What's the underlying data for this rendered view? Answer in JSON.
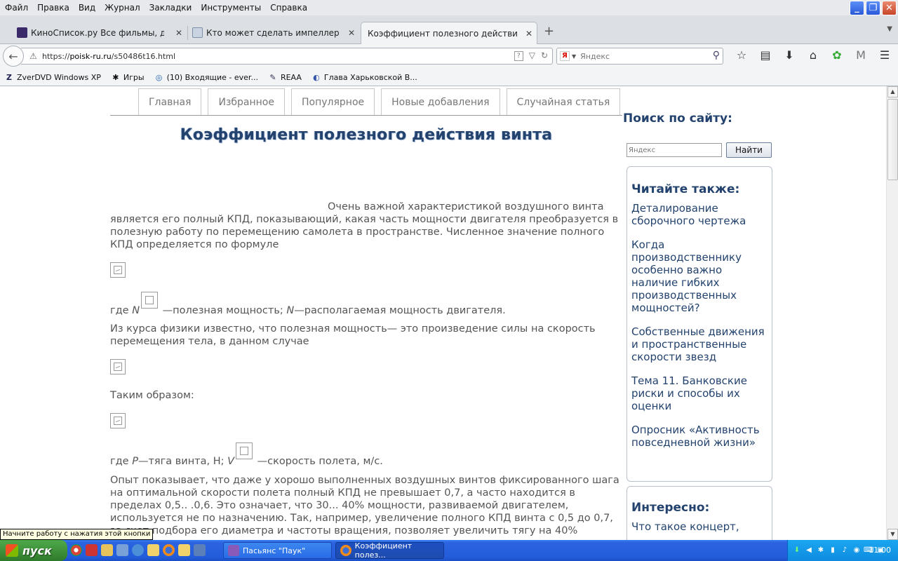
{
  "menu": [
    "Файл",
    "Правка",
    "Вид",
    "Журнал",
    "Закладки",
    "Инструменты",
    "Справка"
  ],
  "window_controls": {
    "minimize": "_",
    "restore": "❐",
    "close": "✕"
  },
  "tabs": [
    {
      "title": "КиноСписок.ру Все фильмы, докум...",
      "close": "✕"
    },
    {
      "title": "Кто может сделать импеллер? | Ст...",
      "close": "✕"
    },
    {
      "title": "Коэффициент полезного действия винта",
      "close": "✕"
    }
  ],
  "new_tab": "+",
  "url": {
    "scheme": "https://",
    "host": "poisk-ru.ru",
    "path": "/s50486t16.html"
  },
  "search": {
    "placeholder": "Яндекс",
    "engine_icon": "Я"
  },
  "bookmarks": [
    "ZverDVD Windows XP",
    "Игры",
    "(10) Входящие - ever...",
    "REAA",
    "Глава Харьковской В..."
  ],
  "site_nav": [
    "Главная",
    "Избранное",
    "Популярное",
    "Новые добавления",
    "Случайная статья"
  ],
  "article": {
    "title": "Коэффициент полезного действия винта",
    "p1": "Очень важной характеристикой воздушного винта является его полный КПД, показывающий, какая часть мощности двигателя преобразуется в полезную работу по перемещению самолета в пространстве. Численное значение полного КПД определяется по формуле",
    "p2_a": "где ",
    "p2_n": "N",
    "p2_b": " —полезная мощность; ",
    "p2_n2": "N",
    "p2_c": "—располагаемая мощность двигателя.",
    "p3": "Из курса физики известно, что полезная мощность— это произведение силы на скорость перемещения тела, в данном случае",
    "p4": "Таким образом:",
    "p5_a": "где ",
    "p5_p": "P",
    "p5_b": "—тяга винта, Н; ",
    "p5_v": "V",
    "p5_c": " —скорость полета, м/с.",
    "p6": "Опыт показывает, что даже у хорошо выполненных воздушных винтов фиксированного шага на оптимальной скорости полета полный КПД не превышает 0,7, а часто находится в пределах 0,5.. .0,6. Это означает, что 30... 40% мощности, развиваемой двигателем, используется не по назначению. Так, например, увеличение полного КПД винта с 0,5 до 0,7, за счет подбора его диаметра и частоты вращения, позволяет увеличить тягу на 40%"
  },
  "sidebar": {
    "search_title": "Поиск по сайту:",
    "search_placeholder": "Яндекс",
    "search_button": "Найти",
    "read_also_title": "Читайте также:",
    "read_also": [
      "Деталирование сборочного чертежа",
      "Когда производственнику особенно важно наличие гибких производственных мощностей?",
      "Собственные движения и пространственные скорости звезд",
      "Тема 11. Банковские риски и способы их оценки",
      "Опросник «Активность повседневной жизни»"
    ],
    "interesting_title": "Интересно:",
    "interesting": [
      "Что такое концерт,"
    ]
  },
  "status_tip": "Начните работу с нажатия этой кнопки",
  "taskbar": {
    "start": "пуск",
    "tasks": [
      "Пасьянс \"Паук\"",
      "Коэффициент полез..."
    ],
    "clock": "11:00"
  }
}
